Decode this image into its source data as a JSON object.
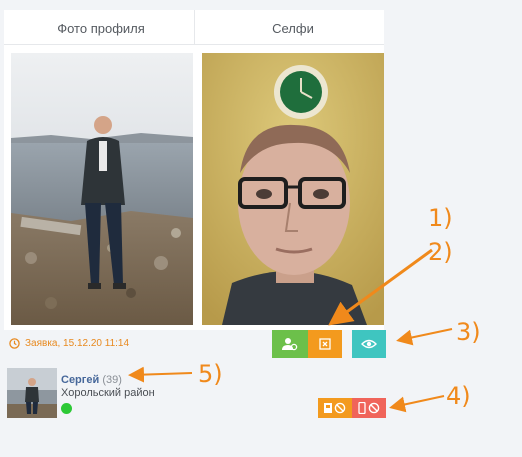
{
  "columns": {
    "profile_photo_title": "Фото профиля",
    "selfie_title": "Селфи"
  },
  "request": {
    "label": "Заявка, 15.12.20 11:14",
    "icon": "clock-icon"
  },
  "actions": {
    "approve_icon": "user-check-icon",
    "reject_icon": "square-x-icon",
    "view_icon": "eye-icon",
    "colors": {
      "green": "#6cc04a",
      "orange": "#f39a1e",
      "teal": "#3fc5c0",
      "red": "#f0645a"
    }
  },
  "block_actions": {
    "block_profile_icon": "id-card-ban-icon",
    "block_phone_icon": "phone-ban-icon"
  },
  "user": {
    "name": "Сергей",
    "age": "(39)",
    "region": "Хорольский район",
    "status": "online"
  },
  "annotations": {
    "n1": "1)",
    "n2": "2)",
    "n3": "3)",
    "n4": "4)",
    "n5": "5)",
    "color": "#f0891b"
  }
}
